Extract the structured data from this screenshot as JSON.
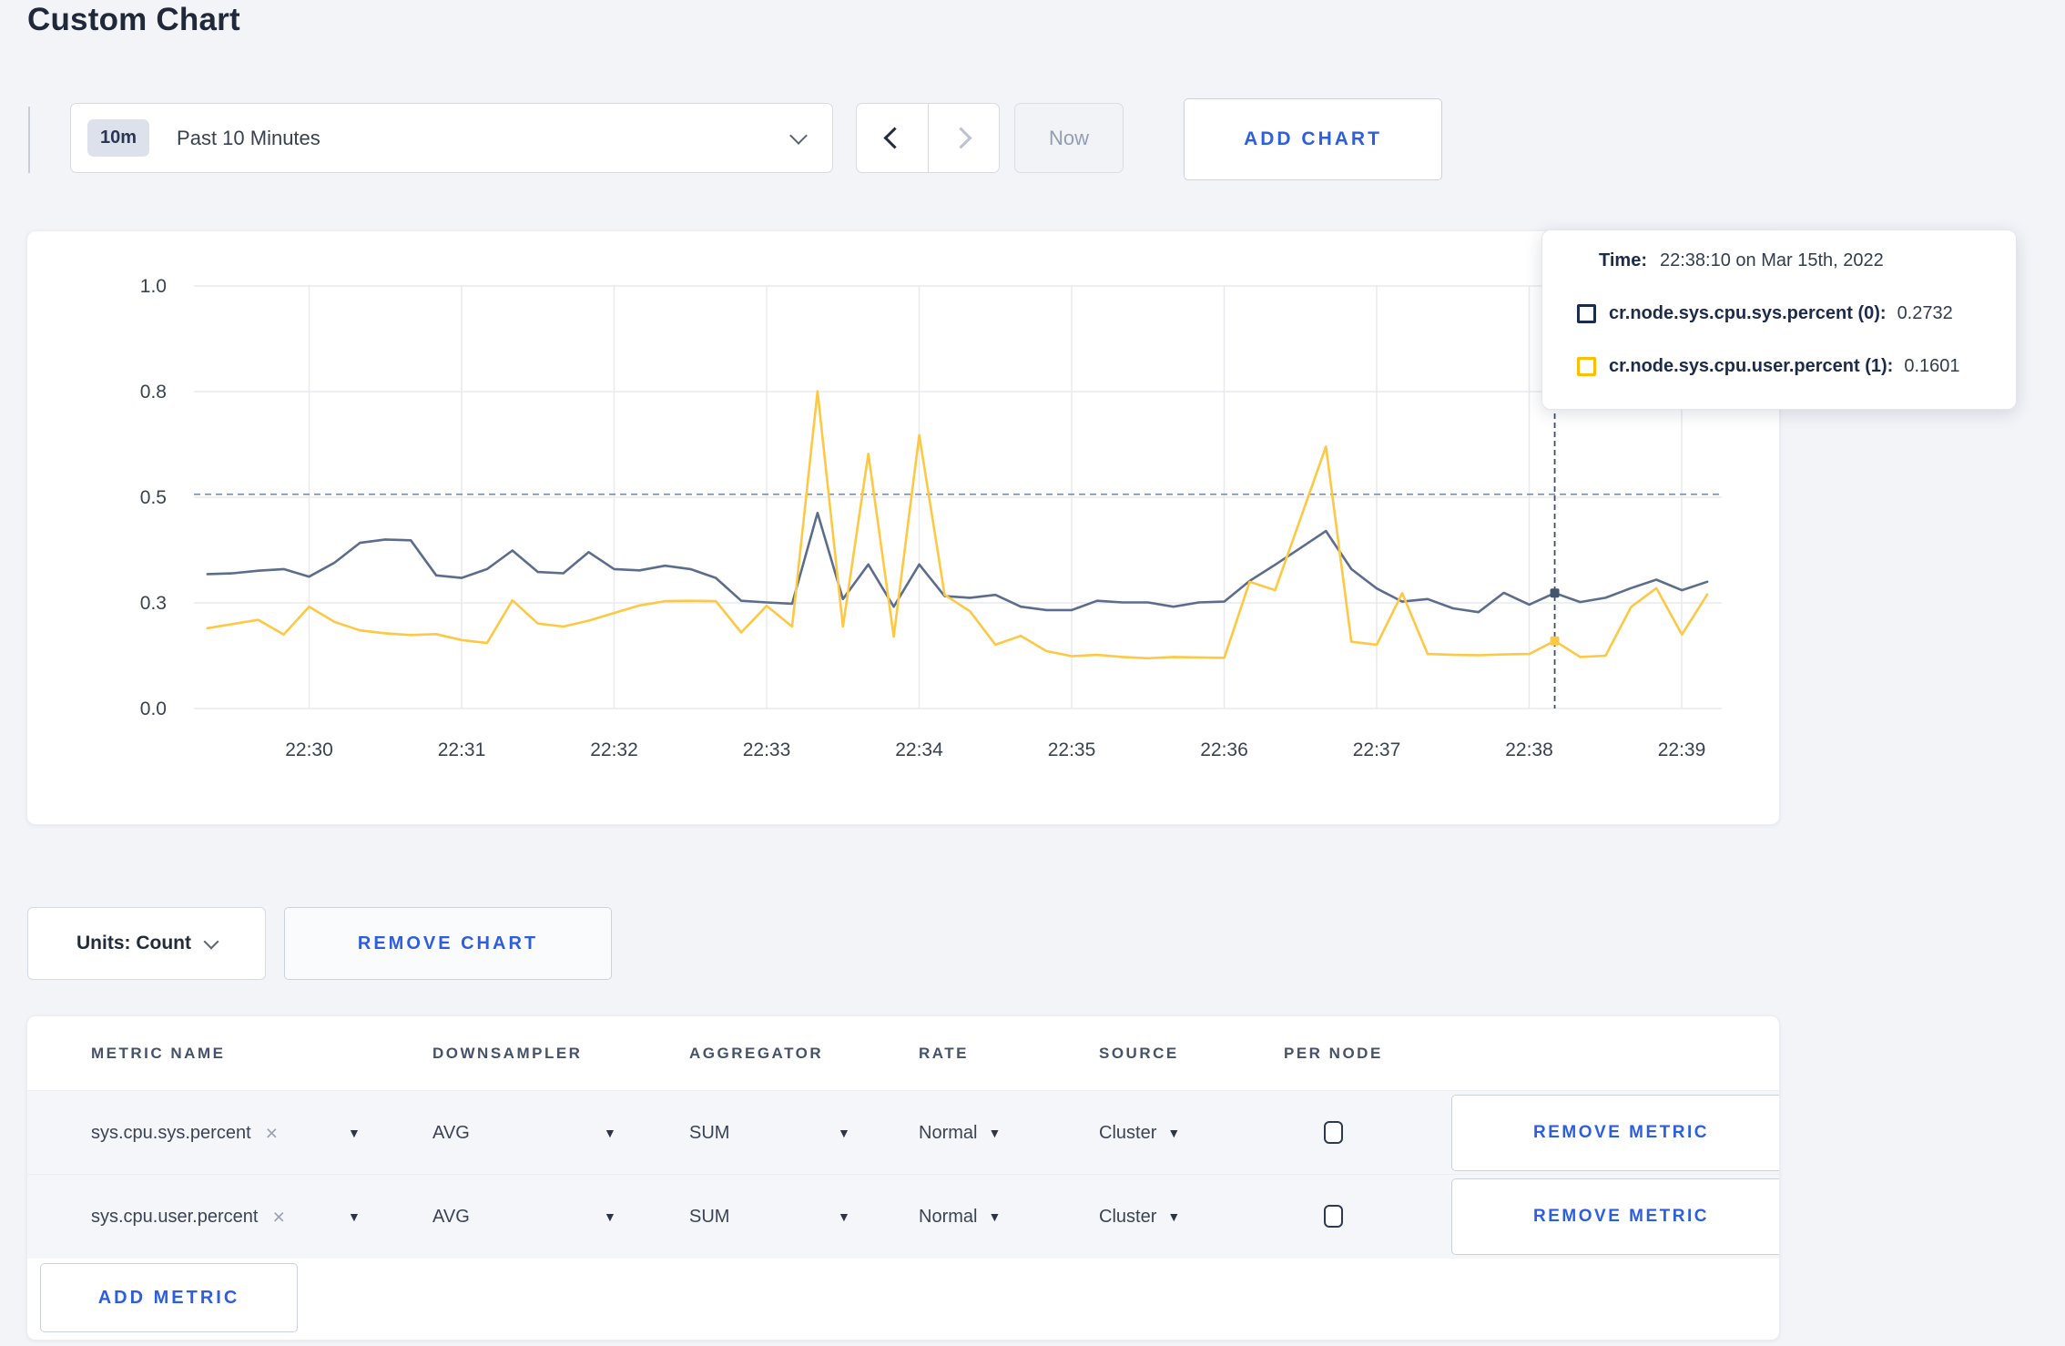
{
  "page": {
    "title": "Custom Chart"
  },
  "toolbar": {
    "range_badge": "10m",
    "range_label": "Past 10 Minutes",
    "now_label": "Now",
    "add_chart_label": "ADD CHART"
  },
  "chart_data": {
    "type": "line",
    "x_start": "22:29:20",
    "interval_seconds": 10,
    "x_tick_labels": [
      "22:30",
      "22:31",
      "22:32",
      "22:33",
      "22:34",
      "22:35",
      "22:36",
      "22:37",
      "22:38",
      "22:39"
    ],
    "y_ticks": [
      {
        "label": "0.0",
        "value": 0
      },
      {
        "label": "0.3",
        "value": 0.25
      },
      {
        "label": "0.5",
        "value": 0.5
      },
      {
        "label": "0.8",
        "value": 0.75
      },
      {
        "label": "1.0",
        "value": 1.0
      }
    ],
    "ylim": [
      0,
      1
    ],
    "grid": true,
    "legend_position": "tooltip-only",
    "series": [
      {
        "name": "cr.node.sys.cpu.sys.percent (0)",
        "color": "#5c6d8c",
        "values": [
          0.318,
          0.32,
          0.326,
          0.33,
          0.312,
          0.345,
          0.392,
          0.4,
          0.398,
          0.315,
          0.309,
          0.33,
          0.374,
          0.323,
          0.32,
          0.37,
          0.33,
          0.327,
          0.338,
          0.33,
          0.309,
          0.255,
          0.251,
          0.248,
          0.463,
          0.259,
          0.341,
          0.241,
          0.341,
          0.266,
          0.262,
          0.269,
          0.241,
          0.233,
          0.233,
          0.255,
          0.251,
          0.251,
          0.241,
          0.251,
          0.253,
          0.302,
          0.34,
          0.38,
          0.42,
          0.33,
          0.284,
          0.253,
          0.259,
          0.237,
          0.228,
          0.274,
          0.246,
          0.2732,
          0.252,
          0.262,
          0.285,
          0.305,
          0.28,
          0.3
        ]
      },
      {
        "name": "cr.node.sys.cpu.user.percent (1)",
        "color": "#fdc844",
        "values": [
          0.19,
          0.2,
          0.21,
          0.175,
          0.241,
          0.205,
          0.185,
          0.178,
          0.174,
          0.176,
          0.162,
          0.155,
          0.256,
          0.201,
          0.194,
          0.208,
          0.226,
          0.244,
          0.254,
          0.255,
          0.254,
          0.18,
          0.243,
          0.194,
          0.751,
          0.194,
          0.603,
          0.17,
          0.647,
          0.269,
          0.23,
          0.151,
          0.172,
          0.136,
          0.124,
          0.127,
          0.122,
          0.119,
          0.122,
          0.121,
          0.12,
          0.3,
          0.28,
          0.45,
          0.62,
          0.158,
          0.151,
          0.273,
          0.129,
          0.127,
          0.126,
          0.128,
          0.129,
          0.1601,
          0.122,
          0.125,
          0.24,
          0.285,
          0.175,
          0.27
        ]
      }
    ],
    "hover": {
      "index": 53,
      "time": "22:38:10",
      "guide_value": 0.507,
      "values": [
        0.2732,
        0.1601
      ]
    }
  },
  "tooltip": {
    "time_prefix": "Time:",
    "time": "22:38:10 on Mar 15th, 2022",
    "entries": [
      {
        "label": "cr.node.sys.cpu.sys.percent (0):",
        "value": "0.2732",
        "color": "#1c2c4f"
      },
      {
        "label": "cr.node.sys.cpu.user.percent (1):",
        "value": "0.1601",
        "color": "#ffbe00"
      }
    ]
  },
  "chart_controls": {
    "units_label": "Units: Count",
    "remove_chart_label": "REMOVE CHART"
  },
  "metrics_table": {
    "headers": [
      "METRIC NAME",
      "DOWNSAMPLER",
      "AGGREGATOR",
      "RATE",
      "SOURCE",
      "PER NODE"
    ],
    "rows": [
      {
        "metric": "sys.cpu.sys.percent",
        "clear_icon": "×",
        "downsampler": "AVG",
        "aggregator": "SUM",
        "rate": "Normal",
        "source": "Cluster",
        "per_node_checked": false,
        "remove_label": "REMOVE METRIC"
      },
      {
        "metric": "sys.cpu.user.percent",
        "clear_icon": "×",
        "downsampler": "AVG",
        "aggregator": "SUM",
        "rate": "Normal",
        "source": "Cluster",
        "per_node_checked": false,
        "remove_label": "REMOVE METRIC"
      }
    ],
    "add_metric_label": "ADD METRIC"
  },
  "colors": {
    "accent_blue": "#2e5ee0",
    "page_background": "#f3f4f8",
    "gridline": "#e9eaee",
    "crosshair": "#3e4f68",
    "guide_line": "#8093ab"
  }
}
